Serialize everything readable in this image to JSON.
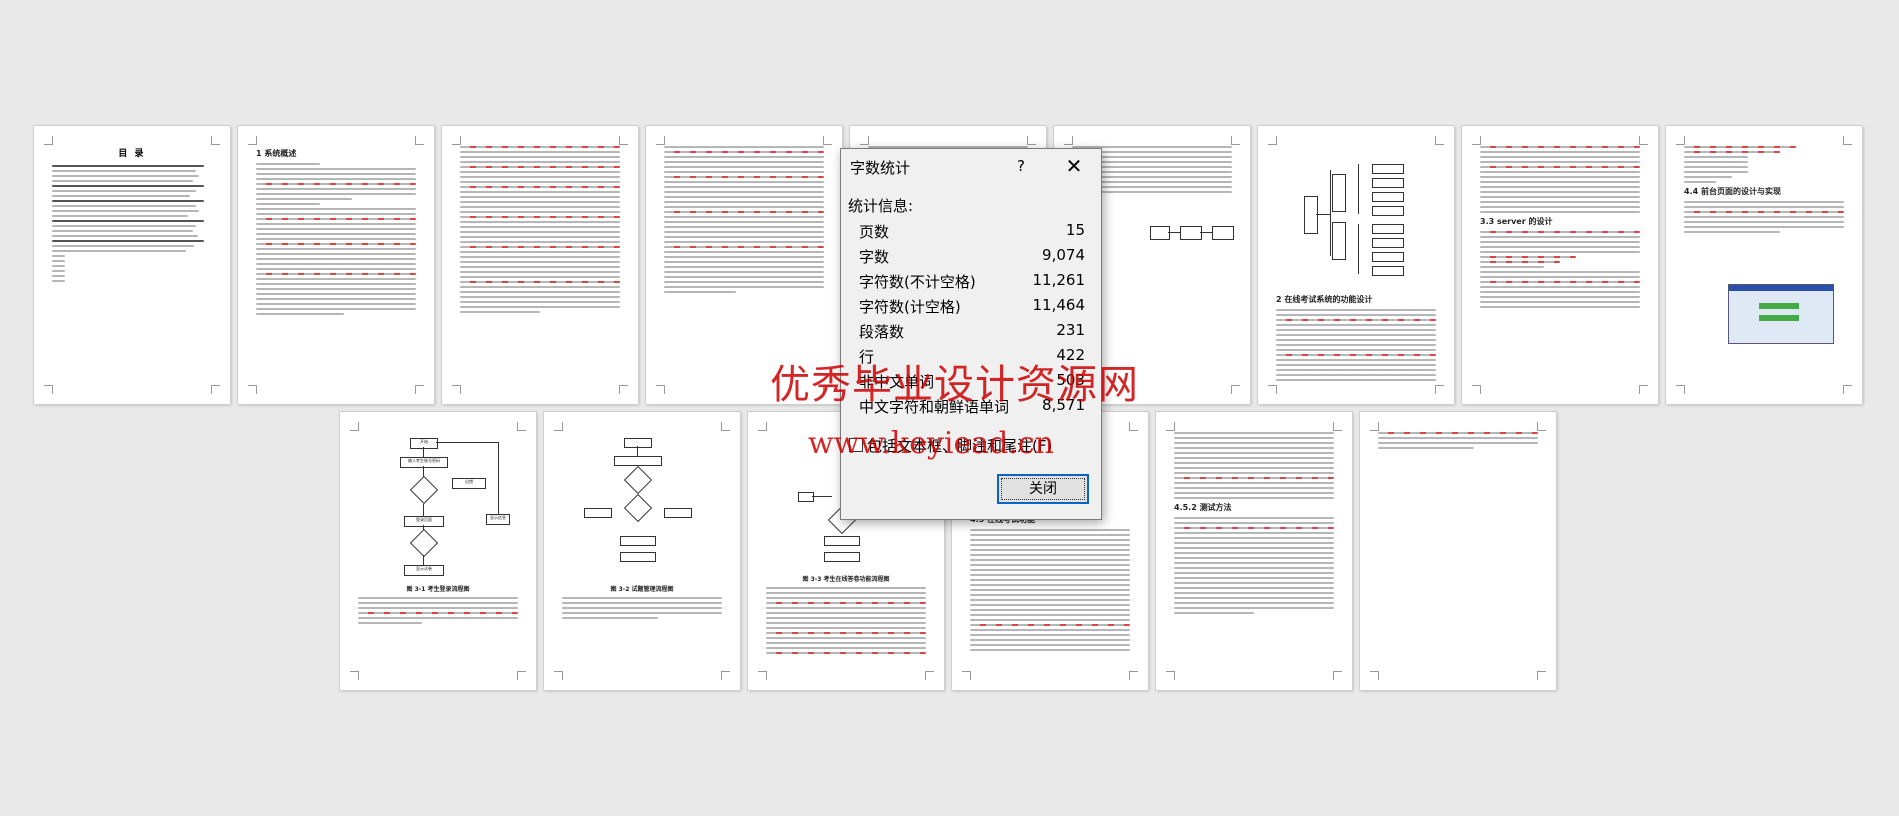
{
  "pages_row1": [
    {
      "heading": "目  录"
    },
    {
      "heading": "1 系统概述"
    },
    {
      "heading": ""
    },
    {
      "heading": ""
    },
    {
      "heading": ""
    },
    {
      "heading": ""
    },
    {
      "heading": "2 在线考试系统的功能设计"
    },
    {
      "heading": "3.3 server 的设计"
    },
    {
      "heading": "4.4 前台页面的设计与实现"
    }
  ],
  "pages_row2": [
    {
      "heading": "图 3-1 考生登录流程图"
    },
    {
      "heading": "图 3-2 试题管理流程图"
    },
    {
      "heading": "图 3-3 考生在线答卷功能流程图"
    },
    {
      "heading": "4.5 在线考试功能"
    },
    {
      "heading": "4.5.2 测试方法"
    },
    {
      "heading": ""
    }
  ],
  "flowchart": {
    "start": "开始",
    "input": "输入考生账号密码",
    "check": "是否账户密码正确",
    "login": "登录页面",
    "exam": "显示试卷",
    "end": "结束",
    "err": "出错",
    "page": "显示信息"
  },
  "dialog": {
    "title": "字数统计",
    "help": "?",
    "close_x": "✕",
    "section": "统计信息:",
    "stats": [
      {
        "label": "页数",
        "value": "15"
      },
      {
        "label": "字数",
        "value": "9,074"
      },
      {
        "label": "字符数(不计空格)",
        "value": "11,261"
      },
      {
        "label": "字符数(计空格)",
        "value": "11,464"
      },
      {
        "label": "段落数",
        "value": "231"
      },
      {
        "label": "行",
        "value": "422"
      },
      {
        "label": "非中文单词",
        "value": "503"
      },
      {
        "label": "中文字符和朝鲜语单词",
        "value": "8,571"
      }
    ],
    "checkbox_label": "包括文本框、脚注和尾注(F)",
    "close_button": "关闭"
  },
  "watermark": {
    "line1": "优秀毕业设计资源网",
    "line2": "www.keyiead.cn"
  }
}
